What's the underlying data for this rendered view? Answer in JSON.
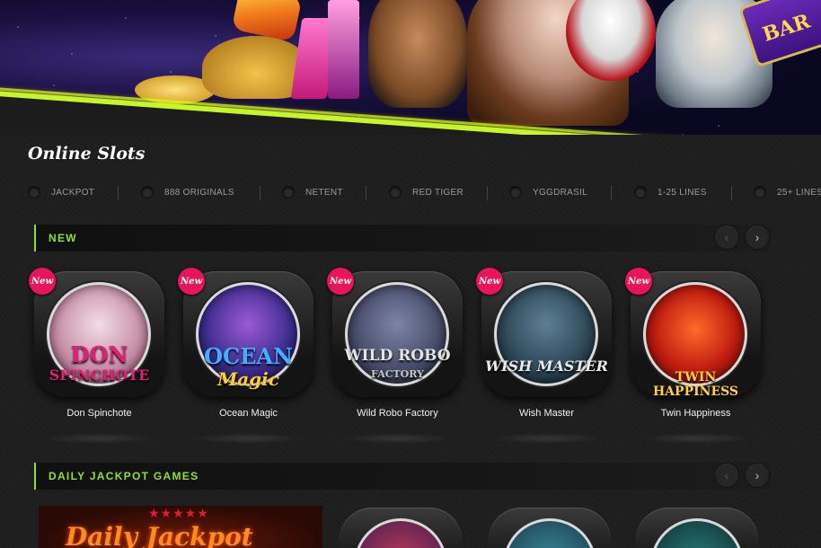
{
  "page": {
    "title": "Online Slots"
  },
  "banner": {
    "sign_text": "BAR"
  },
  "filters": [
    {
      "label": "JACKPOT"
    },
    {
      "label": "888 ORIGINALS"
    },
    {
      "label": "NETENT"
    },
    {
      "label": "RED TIGER"
    },
    {
      "label": "YGGDRASIL"
    },
    {
      "label": "1-25 LINES"
    },
    {
      "label": "25+ LINES"
    }
  ],
  "sections": [
    {
      "title": "NEW",
      "prev_icon": "chevron-left-icon",
      "next_icon": "chevron-right-icon",
      "games": [
        {
          "name": "Don Spinchote",
          "badge": "New",
          "logo_line1": "DON",
          "logo_line2": "SPINCHOTE",
          "bg": "#d9b6c9",
          "color": "#e21f75"
        },
        {
          "name": "Ocean Magic",
          "badge": "New",
          "logo_line1": "OCEAN",
          "logo_line2": "Magic",
          "bg": "#4a3f9a",
          "color": "#3fb0ff"
        },
        {
          "name": "Wild Robo Factory",
          "badge": "New",
          "logo_line1": "WILD ROBO",
          "logo_line2": "FACTORY",
          "bg": "#4a4f64",
          "color": "#e4e4e4"
        },
        {
          "name": "Wish Master",
          "badge": "New",
          "logo_line1": "WISH MASTER",
          "logo_line2": "",
          "bg": "#2f4a5a",
          "color": "#e8e8e8"
        },
        {
          "name": "Twin Happiness",
          "badge": "New",
          "logo_line1": "TWIN HAPPINESS",
          "logo_line2": "",
          "bg": "#a8150f",
          "color": "#ffd33a"
        }
      ]
    },
    {
      "title": "DAILY JACKPOT GAMES",
      "prev_icon": "chevron-left-icon",
      "next_icon": "chevron-right-icon",
      "banner_title": "Daily Jackpot",
      "banner_stars": "★★★★★"
    }
  ],
  "colors": {
    "accent": "#8fe02a",
    "new_badge": "#e8155b",
    "banner_stripe": "#c6f52a"
  }
}
